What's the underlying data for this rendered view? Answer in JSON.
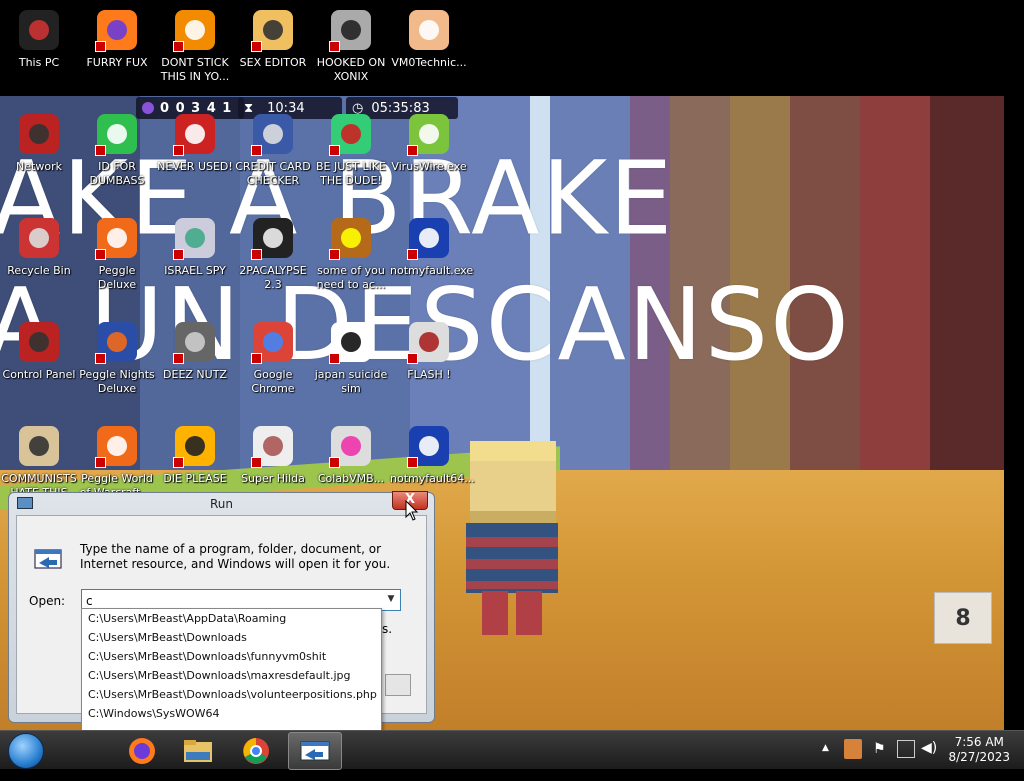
{
  "desktop": {
    "top_row": [
      {
        "label": "This PC",
        "icon": "this-pc-icon"
      },
      {
        "label": "FURRY FUX",
        "icon": "firefox-icon"
      },
      {
        "label": "DONT STICK THIS IN YO...",
        "icon": "vlc-icon"
      },
      {
        "label": "SEX EDITOR",
        "icon": "hxd-icon"
      },
      {
        "label": "HOOKED ON XONIX",
        "icon": "xonix-icon"
      },
      {
        "label": "VM0Technic...",
        "icon": "doctor-icon"
      }
    ],
    "row1": [
      {
        "label": "Network",
        "icon": "network-icon"
      },
      {
        "label": "ID FOR DUMBASS",
        "icon": "chat-icon"
      },
      {
        "label": "NEVER USED!",
        "icon": "dev-cpp-icon"
      },
      {
        "label": "CREDIT CARD CHECKER",
        "icon": "card-icon"
      },
      {
        "label": "BE JUST LIKE THE DUDE!",
        "icon": "santa-icon"
      },
      {
        "label": "VirusWire.exe",
        "icon": "lime-icon"
      }
    ],
    "row2": [
      {
        "label": "Recycle Bin",
        "icon": "recycle-bin-icon"
      },
      {
        "label": "Peggle Deluxe",
        "icon": "peggle-icon"
      },
      {
        "label": "ISRAEL SPY",
        "icon": "spy-icon"
      },
      {
        "label": "2PACALYPSE 2.3",
        "icon": "terminal-icon"
      },
      {
        "label": "some of you need to ac...",
        "icon": "dog-icon"
      },
      {
        "label": "notmyfault.exe",
        "icon": "bsod-icon"
      }
    ],
    "row3": [
      {
        "label": "Control Panel",
        "icon": "control-panel-icon"
      },
      {
        "label": "Peggle Nights Deluxe",
        "icon": "peggle-nights-icon"
      },
      {
        "label": "DEEZ NUTZ",
        "icon": "windows-stack-icon"
      },
      {
        "label": "Google Chrome",
        "icon": "chrome-icon"
      },
      {
        "label": "japan suicide sim",
        "icon": "anime-icon"
      },
      {
        "label": "FLASH !",
        "icon": "flash-icon"
      }
    ],
    "row4": [
      {
        "label": "COMMUNISTS HATE THIS G...",
        "icon": "money-bag-icon"
      },
      {
        "label": "Peggle World of Warcraft ...",
        "icon": "peggle-wow-icon"
      },
      {
        "label": "DIE PLEASE",
        "icon": "de-icon"
      },
      {
        "label": "Super Hilda",
        "icon": "pixel-char-icon"
      },
      {
        "label": "ColabVMB...",
        "icon": "monitor-icon"
      },
      {
        "label": "notmyfault64...",
        "icon": "bsod-icon"
      }
    ]
  },
  "game": {
    "sign_line1": "AKE A BRAKE",
    "sign_line2": "A UN DESCANSO",
    "hud_counter": "0 0 3 4 1",
    "hud_timer": "10:34",
    "hud_clock": "05:35:83",
    "hud_number": "8"
  },
  "run_dialog": {
    "title": "Run",
    "close_label": "X",
    "description": "Type the name of a program, folder, document, or Internet resource, and Windows will open it for you.",
    "open_label": "Open:",
    "open_value": "c",
    "hidden_suffix": "s.",
    "suggestions": [
      "C:\\Users\\MrBeast\\AppData\\Roaming",
      "C:\\Users\\MrBeast\\Downloads",
      "C:\\Users\\MrBeast\\Downloads\\funnyvm0shit",
      "C:\\Users\\MrBeast\\Downloads\\maxresdefault.jpg",
      "C:\\Users\\MrBeast\\Downloads\\volunteerpositions.php",
      "C:\\Windows\\SysWOW64"
    ]
  },
  "taskbar": {
    "apps": [
      "firefox-icon",
      "explorer-icon",
      "chrome-icon",
      "run-icon"
    ],
    "time": "7:56 AM",
    "date": "8/27/2023"
  }
}
